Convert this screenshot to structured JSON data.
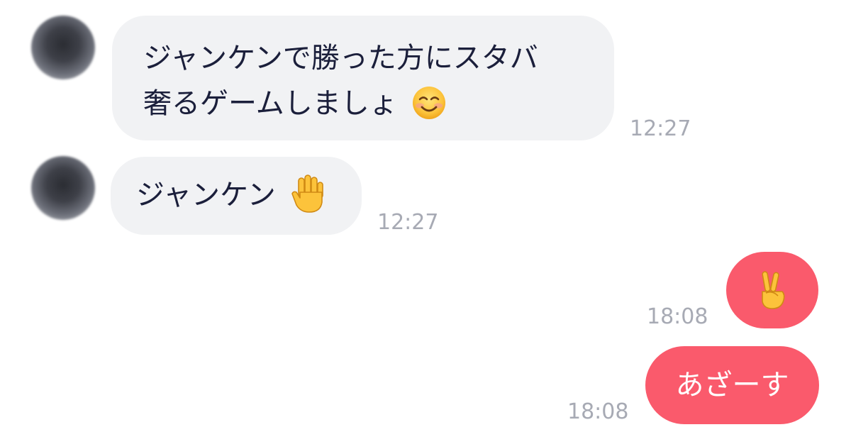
{
  "messages": [
    {
      "direction": "incoming",
      "lines": [
        "ジャンケンで勝った方にスタバ",
        "奢るゲームしましょ"
      ],
      "emoji": "smiling-face-icon",
      "time": "12:27"
    },
    {
      "direction": "incoming",
      "text": "ジャンケン",
      "emoji": "raised-hand-icon",
      "time": "12:27"
    },
    {
      "direction": "outgoing",
      "emoji": "victory-hand-icon",
      "time": "18:08"
    },
    {
      "direction": "outgoing",
      "text": "あざーす",
      "time": "18:08"
    }
  ],
  "colors": {
    "incoming_bubble": "#f1f2f4",
    "outgoing_bubble": "#fa5a6c",
    "incoming_text": "#1b1f3b",
    "outgoing_text": "#ffffff",
    "timestamp": "#a7aab4"
  }
}
